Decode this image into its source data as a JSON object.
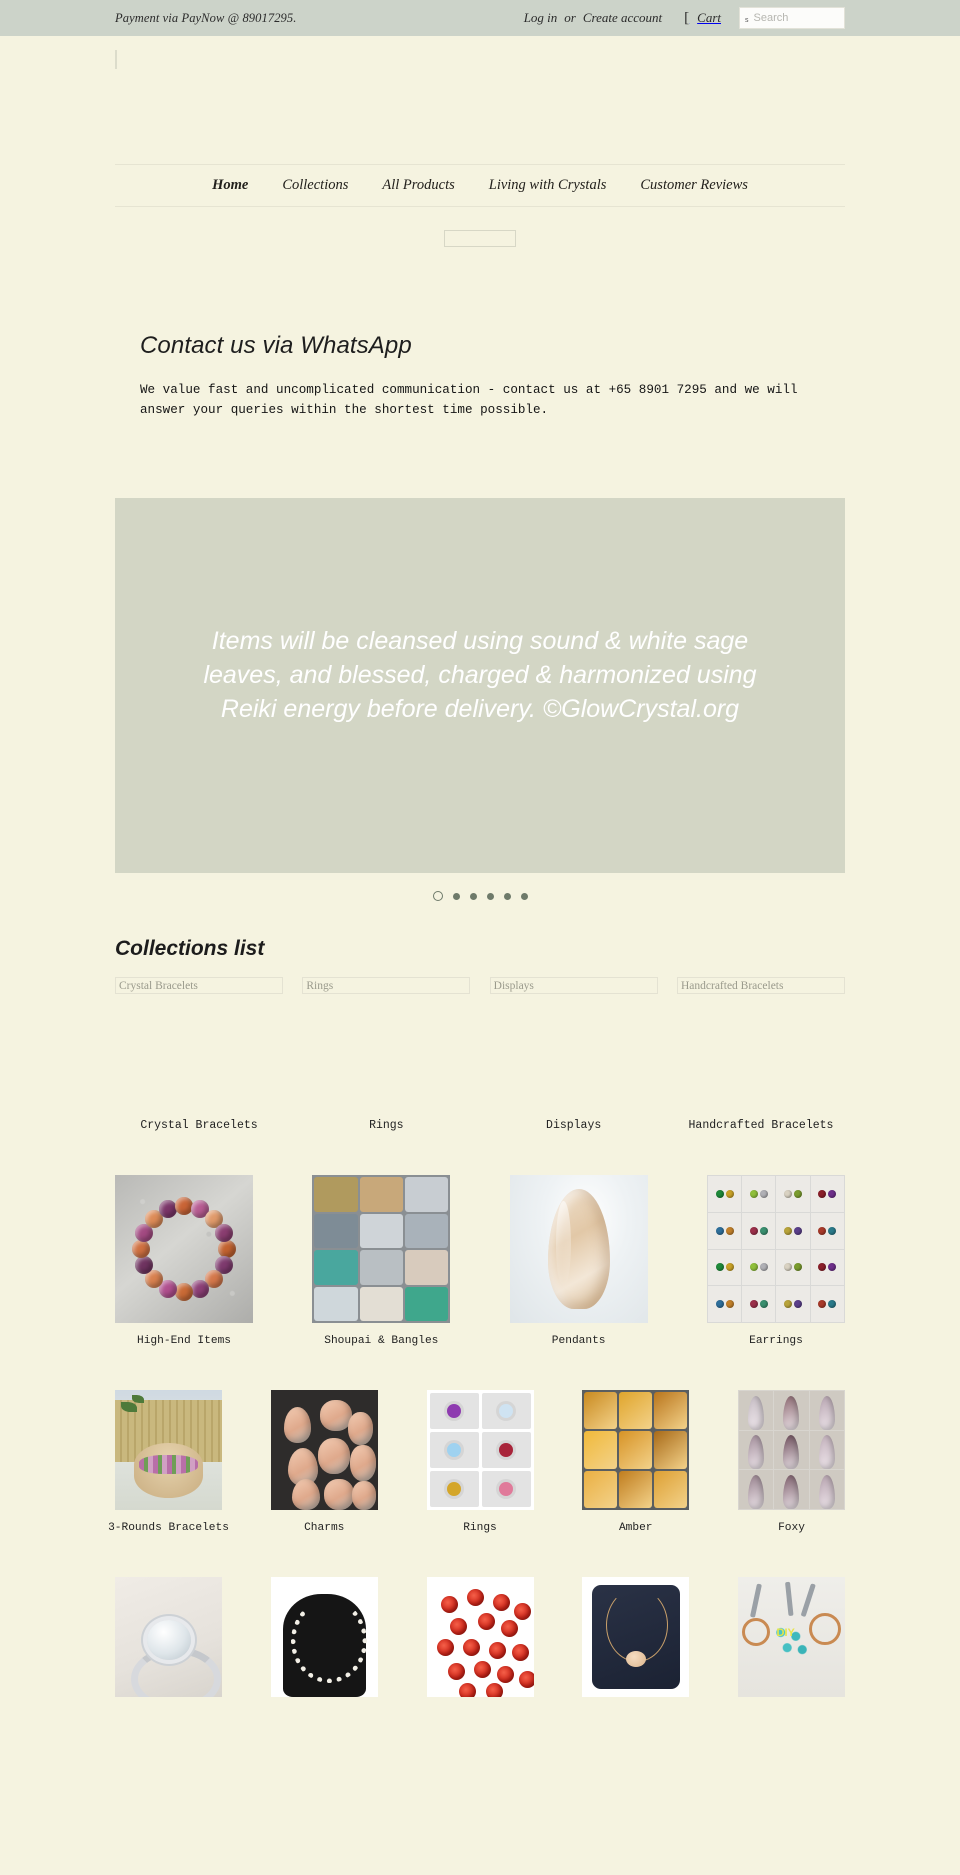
{
  "topbar": {
    "paynow": "Payment via PayNow @ 89017295.",
    "login": "Log in",
    "or": "or",
    "create_account": "Create account",
    "cart_icon": "cart-icon",
    "cart": "Cart",
    "search_icon": "search-icon",
    "search_placeholder": "Search",
    "search_value": "",
    "bg_color": "#ccd3c9"
  },
  "header": {
    "logo_alt": ""
  },
  "nav": {
    "items": [
      {
        "label": "Home",
        "active": true
      },
      {
        "label": "Collections",
        "active": false
      },
      {
        "label": "All Products",
        "active": false
      },
      {
        "label": "Living with Crystals",
        "active": false
      },
      {
        "label": "Customer Reviews",
        "active": false
      }
    ]
  },
  "whatsapp": {
    "title": "Contact us via WhatsApp",
    "body": "We value fast and uncomplicated communication - contact us at +65 8901 7295 and we will answer your queries within the shortest time possible."
  },
  "hero": {
    "text": "Items will be cleansed using sound & white sage leaves, and blessed, charged & harmonized using Reiki energy before delivery. ©GlowCrystal.org",
    "bg_color": "#d3d6c5",
    "dots_total": 6,
    "dots_current": 1
  },
  "collections": {
    "title": "Collections list",
    "items": [
      {
        "alt": "Crystal Bracelets",
        "caption": "Crystal Bracelets"
      },
      {
        "alt": "Rings",
        "caption": "Rings"
      },
      {
        "alt": "Displays",
        "caption": "Displays"
      },
      {
        "alt": "Handcrafted Bracelets",
        "caption": "Handcrafted Bracelets"
      }
    ]
  },
  "grid_row2": [
    {
      "caption": "High-End Items"
    },
    {
      "caption": "Shoupai & Bangles"
    },
    {
      "caption": "Pendants"
    },
    {
      "caption": "Earrings"
    }
  ],
  "grid_row3": [
    {
      "caption": "3-Rounds Bracelets"
    },
    {
      "caption": "Charms"
    },
    {
      "caption": "Rings"
    },
    {
      "caption": "Amber"
    },
    {
      "caption": "Foxy"
    }
  ],
  "grid_row4": [
    {
      "caption": ""
    },
    {
      "caption": ""
    },
    {
      "caption": ""
    },
    {
      "caption": ""
    },
    {
      "caption": ""
    }
  ],
  "page": {
    "bg_color": "#f5f3e0"
  }
}
